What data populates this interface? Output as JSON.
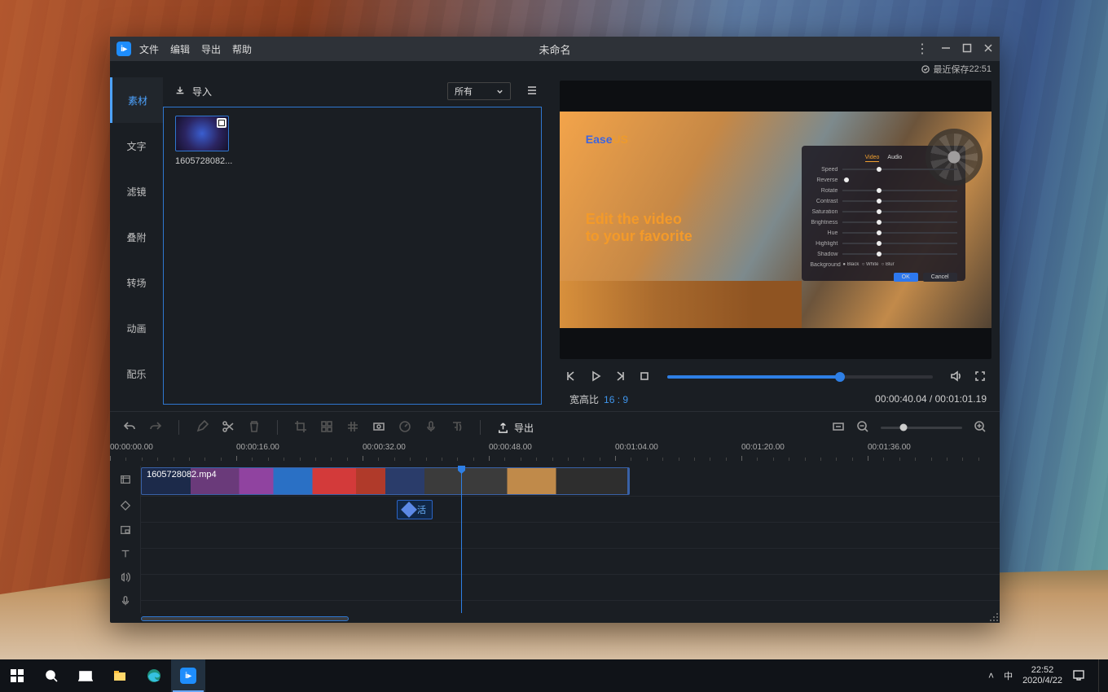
{
  "os": {
    "ime": "中",
    "time": "22:52",
    "date": "2020/4/22"
  },
  "app": {
    "title": "未命名",
    "menus": [
      "文件",
      "编辑",
      "导出",
      "帮助"
    ],
    "saved_prefix": "最近保存 ",
    "saved_time": "22:51"
  },
  "sidebar": {
    "items": [
      "素材",
      "文字",
      "滤镜",
      "叠附",
      "转场",
      "动画",
      "配乐"
    ],
    "active": 0
  },
  "media": {
    "import_label": "导入",
    "filter_selected": "所有",
    "thumb_label": "1605728082.mp4",
    "thumb_display": "1605728082..."
  },
  "preview": {
    "brand_a": "Ease",
    "brand_b": "US",
    "headline_l1": "Edit the video",
    "headline_l2": "to your favorite",
    "panel": {
      "tabs": [
        "Video",
        "Audio"
      ],
      "rows": [
        "Speed",
        "Reverse",
        "Rotate",
        "Contrast",
        "Saturation",
        "Brightness",
        "Hue",
        "Highlight",
        "Shadow"
      ],
      "bg_label": "Background",
      "bg_opts": [
        "Black",
        "White",
        "Blur"
      ],
      "ok": "OK",
      "cancel": "Cancel"
    },
    "ratio_label": "宽高比",
    "ratio_value": "16 : 9",
    "current": "00:00:40.04",
    "total": "00:01:01.19",
    "progress_pct": 65
  },
  "toolbar": {
    "export_label": "导出"
  },
  "timeline": {
    "ticks": [
      "00:00:00.00",
      "00:00:16.00",
      "00:00:32.00",
      "00:00:48.00",
      "00:01:04.00",
      "00:01:20.00",
      "00:01:36.00"
    ],
    "clip_name": "1605728082.mp4",
    "overlay_label": "活",
    "playhead_pct": 39.3
  }
}
